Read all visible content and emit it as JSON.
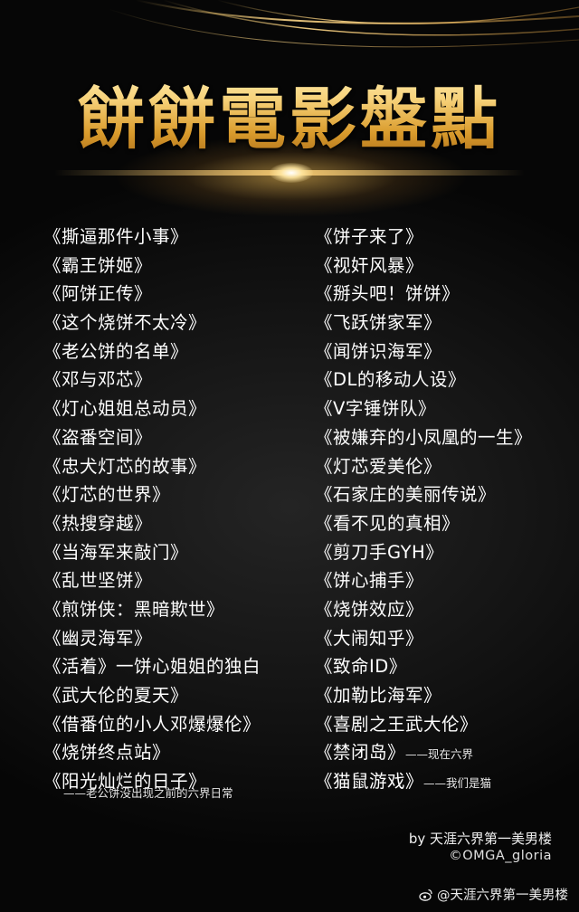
{
  "title": "餅餅電影盤點",
  "left_column": [
    {
      "text": "《撕逼那件小事》"
    },
    {
      "text": "《霸王饼姬》"
    },
    {
      "text": "《阿饼正传》"
    },
    {
      "text": "《这个烧饼不太冷》"
    },
    {
      "text": "《老公饼的名单》"
    },
    {
      "text": "《邓与邓芯》"
    },
    {
      "text": "《灯心姐姐总动员》"
    },
    {
      "text": "《盗番空间》"
    },
    {
      "text": "《忠犬灯芯的故事》"
    },
    {
      "text": "《灯芯的世界》"
    },
    {
      "text": "《热搜穿越》"
    },
    {
      "text": "《当海军来敲门》"
    },
    {
      "text": "《乱世坚饼》"
    },
    {
      "text": "《煎饼侠：黑暗欺世》"
    },
    {
      "text": "《幽灵海军》"
    },
    {
      "text": "《活着》一饼心姐姐的独白"
    },
    {
      "text": "《武大伦的夏天》"
    },
    {
      "text": "《借番位的小人邓爆爆伦》"
    },
    {
      "text": "《烧饼终点站》"
    },
    {
      "text": "《阳光灿烂的日子》"
    }
  ],
  "left_subtitle": "——老公饼没出现之前的六界日常",
  "right_column": [
    {
      "text": "《饼子来了》",
      "note": ""
    },
    {
      "text": "《视奸风暴》",
      "note": ""
    },
    {
      "text": "《掰头吧！饼饼》",
      "note": ""
    },
    {
      "text": "《飞跃饼家军》",
      "note": ""
    },
    {
      "text": "《闻饼识海军》",
      "note": ""
    },
    {
      "text": "《DL的移动人设》",
      "note": ""
    },
    {
      "text": "《V字锤饼队》",
      "note": ""
    },
    {
      "text": "《被嫌弃的小凤凰的一生》",
      "note": ""
    },
    {
      "text": "《灯芯爱美伦》",
      "note": ""
    },
    {
      "text": "《石家庄的美丽传说》",
      "note": ""
    },
    {
      "text": "《看不见的真相》",
      "note": ""
    },
    {
      "text": "《剪刀手GYH》",
      "note": ""
    },
    {
      "text": "《饼心捕手》",
      "note": ""
    },
    {
      "text": "《烧饼效应》",
      "note": ""
    },
    {
      "text": "《大闹知乎》",
      "note": ""
    },
    {
      "text": "《致命ID》",
      "note": ""
    },
    {
      "text": "《加勒比海军》",
      "note": ""
    },
    {
      "text": "《喜剧之王武大伦》",
      "note": ""
    },
    {
      "text": "《禁闭岛》",
      "note": "——现在六界"
    },
    {
      "text": "《猫鼠游戏》",
      "note": "——我们是猫"
    }
  ],
  "credit": {
    "by": "by 天涯六界第一美男楼",
    "handle": "©OMGA_gloria"
  },
  "watermark": {
    "icon": "weibo-icon",
    "text": "@天涯六界第一美男楼"
  },
  "colors": {
    "title_gold": "#f2c45a",
    "text": "#ffffff",
    "background": "#141414"
  }
}
